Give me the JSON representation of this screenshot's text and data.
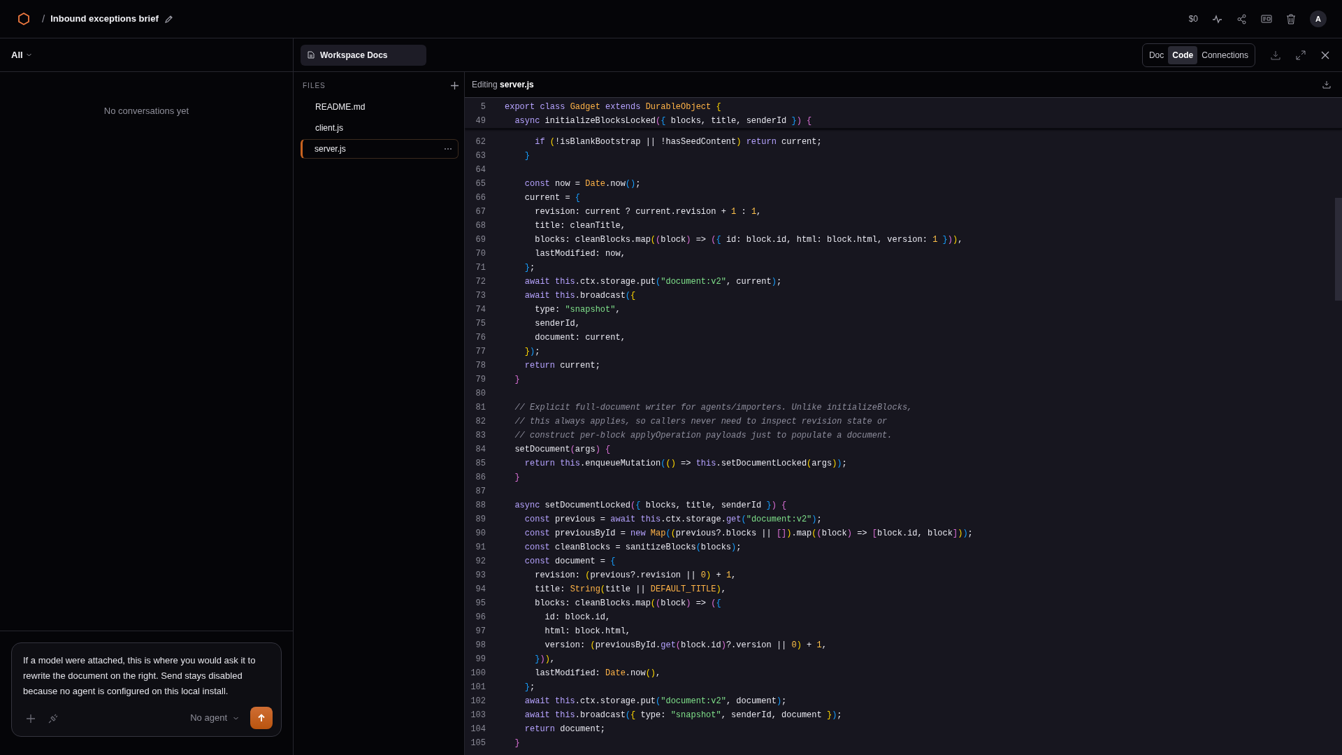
{
  "header": {
    "separator": "/",
    "title": "Inbound exceptions brief",
    "balance": "$0",
    "avatar": "A"
  },
  "sidebar": {
    "filter": "All",
    "empty_message": "No conversations yet",
    "composer": {
      "placeholder": "If a model were attached, this is where you would ask it to rewrite the document on the right. Send stays disabled because no agent is configured on this local install.",
      "agent": "No agent"
    }
  },
  "docs": {
    "tab": "Workspace Docs",
    "views": [
      {
        "label": "Doc",
        "selected": false
      },
      {
        "label": "Code",
        "selected": true
      },
      {
        "label": "Connections",
        "selected": false
      }
    ]
  },
  "files": {
    "heading": "FILES",
    "items": [
      {
        "name": "README.md",
        "selected": false
      },
      {
        "name": "client.js",
        "selected": false
      },
      {
        "name": "server.js",
        "selected": true
      }
    ]
  },
  "editor": {
    "status": "Editing",
    "file": "server.js",
    "sticky_lines": [
      {
        "number": "5",
        "tokens": [
          {
            "kind": "keyword",
            "text": "export class "
          },
          {
            "kind": "type",
            "text": "Gadget"
          },
          {
            "kind": "keyword",
            "text": " extends "
          },
          {
            "kind": "type",
            "text": "DurableObject "
          },
          {
            "kind": "bracket1",
            "text": "{"
          }
        ]
      },
      {
        "number": "49",
        "tokens": [
          {
            "kind": "keyword",
            "text": "  async "
          },
          {
            "kind": "plain",
            "text": "initializeBlocksLocked"
          },
          {
            "kind": "bracket2",
            "text": "("
          },
          {
            "kind": "bracket3",
            "text": "{"
          },
          {
            "kind": "plain",
            "text": " blocks, title, senderId "
          },
          {
            "kind": "bracket3",
            "text": "}"
          },
          {
            "kind": "bracket2",
            "text": ") {"
          }
        ]
      }
    ],
    "lines": [
      {
        "number": "62",
        "tokens": [
          {
            "kind": "keyword",
            "text": "      if "
          },
          {
            "kind": "bracket1",
            "text": "("
          },
          {
            "kind": "plain",
            "text": "!isBlankBootstrap || !hasSeedContent"
          },
          {
            "kind": "bracket1",
            "text": ")"
          },
          {
            "kind": "keyword",
            "text": " return"
          },
          {
            "kind": "plain",
            "text": " current;"
          }
        ]
      },
      {
        "number": "63",
        "tokens": [
          {
            "kind": "bracket3",
            "text": "    }"
          }
        ]
      },
      {
        "number": "64"
      },
      {
        "number": "65",
        "tokens": [
          {
            "kind": "keyword",
            "text": "    const"
          },
          {
            "kind": "plain",
            "text": " now = "
          },
          {
            "kind": "type",
            "text": "Date"
          },
          {
            "kind": "plain",
            "text": ".now"
          },
          {
            "kind": "bracket3",
            "text": "()"
          },
          {
            "kind": "plain",
            "text": ";"
          }
        ]
      },
      {
        "number": "66",
        "tokens": [
          {
            "kind": "plain",
            "text": "    current = "
          },
          {
            "kind": "bracket3",
            "text": "{"
          }
        ]
      },
      {
        "number": "67",
        "tokens": [
          {
            "kind": "plain",
            "text": "      revision: current ? current.revision + "
          },
          {
            "kind": "number",
            "text": "1"
          },
          {
            "kind": "plain",
            "text": " : "
          },
          {
            "kind": "number",
            "text": "1"
          },
          {
            "kind": "plain",
            "text": ","
          }
        ]
      },
      {
        "number": "68",
        "tokens": [
          {
            "kind": "plain",
            "text": "      title: cleanTitle,"
          }
        ]
      },
      {
        "number": "69",
        "tokens": [
          {
            "kind": "plain",
            "text": "      blocks: cleanBlocks.map"
          },
          {
            "kind": "bracket1",
            "text": "("
          },
          {
            "kind": "bracket2",
            "text": "("
          },
          {
            "kind": "plain",
            "text": "block"
          },
          {
            "kind": "bracket2",
            "text": ")"
          },
          {
            "kind": "plain",
            "text": " => "
          },
          {
            "kind": "bracket2",
            "text": "("
          },
          {
            "kind": "bracket3",
            "text": "{"
          },
          {
            "kind": "plain",
            "text": " id: block.id, html: block.html, version: "
          },
          {
            "kind": "number",
            "text": "1 "
          },
          {
            "kind": "bracket3",
            "text": "}"
          },
          {
            "kind": "bracket2",
            "text": ")"
          },
          {
            "kind": "bracket1",
            "text": ")"
          },
          {
            "kind": "plain",
            "text": ","
          }
        ]
      },
      {
        "number": "70",
        "tokens": [
          {
            "kind": "plain",
            "text": "      lastModified: now,"
          }
        ]
      },
      {
        "number": "71",
        "tokens": [
          {
            "kind": "bracket3",
            "text": "    }"
          },
          {
            "kind": "plain",
            "text": ";"
          }
        ]
      },
      {
        "number": "72",
        "tokens": [
          {
            "kind": "keyword",
            "text": "    await this"
          },
          {
            "kind": "plain",
            "text": ".ctx.storage.put"
          },
          {
            "kind": "bracket3",
            "text": "("
          },
          {
            "kind": "string",
            "text": "\"document:v2\""
          },
          {
            "kind": "plain",
            "text": ", current"
          },
          {
            "kind": "bracket3",
            "text": ")"
          },
          {
            "kind": "plain",
            "text": ";"
          }
        ]
      },
      {
        "number": "73",
        "tokens": [
          {
            "kind": "keyword",
            "text": "    await this"
          },
          {
            "kind": "plain",
            "text": ".broadcast"
          },
          {
            "kind": "bracket3",
            "text": "("
          },
          {
            "kind": "bracket1",
            "text": "{"
          }
        ]
      },
      {
        "number": "74",
        "tokens": [
          {
            "kind": "plain",
            "text": "      type: "
          },
          {
            "kind": "string",
            "text": "\"snapshot\""
          },
          {
            "kind": "plain",
            "text": ","
          }
        ]
      },
      {
        "number": "75",
        "tokens": [
          {
            "kind": "plain",
            "text": "      senderId,"
          }
        ]
      },
      {
        "number": "76",
        "tokens": [
          {
            "kind": "plain",
            "text": "      document: current,"
          }
        ]
      },
      {
        "number": "77",
        "tokens": [
          {
            "kind": "bracket1",
            "text": "    }"
          },
          {
            "kind": "bracket3",
            "text": ")"
          },
          {
            "kind": "plain",
            "text": ";"
          }
        ]
      },
      {
        "number": "78",
        "tokens": [
          {
            "kind": "keyword",
            "text": "    return"
          },
          {
            "kind": "plain",
            "text": " current;"
          }
        ]
      },
      {
        "number": "79",
        "tokens": [
          {
            "kind": "bracket2",
            "text": "  }"
          }
        ]
      },
      {
        "number": "80"
      },
      {
        "number": "81",
        "tokens": [
          {
            "kind": "comment",
            "text": "  // Explicit full-document writer for agents/importers. Unlike initializeBlocks,"
          }
        ]
      },
      {
        "number": "82",
        "tokens": [
          {
            "kind": "comment",
            "text": "  // this always applies, so callers never need to inspect revision state or"
          }
        ]
      },
      {
        "number": "83",
        "tokens": [
          {
            "kind": "comment",
            "text": "  // construct per-block applyOperation payloads just to populate a document."
          }
        ]
      },
      {
        "number": "84",
        "tokens": [
          {
            "kind": "plain",
            "text": "  setDocument"
          },
          {
            "kind": "bracket2",
            "text": "("
          },
          {
            "kind": "plain",
            "text": "args"
          },
          {
            "kind": "bracket2",
            "text": ") {"
          }
        ]
      },
      {
        "number": "85",
        "tokens": [
          {
            "kind": "keyword",
            "text": "    return this"
          },
          {
            "kind": "plain",
            "text": ".enqueueMutation"
          },
          {
            "kind": "bracket3",
            "text": "("
          },
          {
            "kind": "bracket1",
            "text": "()"
          },
          {
            "kind": "plain",
            "text": " => "
          },
          {
            "kind": "keyword",
            "text": "this"
          },
          {
            "kind": "plain",
            "text": ".setDocumentLocked"
          },
          {
            "kind": "bracket1",
            "text": "("
          },
          {
            "kind": "plain",
            "text": "args"
          },
          {
            "kind": "bracket1",
            "text": ")"
          },
          {
            "kind": "bracket3",
            "text": ")"
          },
          {
            "kind": "plain",
            "text": ";"
          }
        ]
      },
      {
        "number": "86",
        "tokens": [
          {
            "kind": "bracket2",
            "text": "  }"
          }
        ]
      },
      {
        "number": "87"
      },
      {
        "number": "88",
        "tokens": [
          {
            "kind": "keyword",
            "text": "  async "
          },
          {
            "kind": "plain",
            "text": "setDocumentLocked"
          },
          {
            "kind": "bracket2",
            "text": "("
          },
          {
            "kind": "bracket3",
            "text": "{"
          },
          {
            "kind": "plain",
            "text": " blocks, title, senderId "
          },
          {
            "kind": "bracket3",
            "text": "}"
          },
          {
            "kind": "bracket2",
            "text": ") {"
          }
        ]
      },
      {
        "number": "89",
        "tokens": [
          {
            "kind": "keyword",
            "text": "    const"
          },
          {
            "kind": "plain",
            "text": " previous = "
          },
          {
            "kind": "keyword",
            "text": "await this"
          },
          {
            "kind": "plain",
            "text": ".ctx.storage."
          },
          {
            "kind": "keyword",
            "text": "get"
          },
          {
            "kind": "bracket3",
            "text": "("
          },
          {
            "kind": "string",
            "text": "\"document:v2\""
          },
          {
            "kind": "bracket3",
            "text": ")"
          },
          {
            "kind": "plain",
            "text": ";"
          }
        ]
      },
      {
        "number": "90",
        "tokens": [
          {
            "kind": "keyword",
            "text": "    const"
          },
          {
            "kind": "plain",
            "text": " previousById = "
          },
          {
            "kind": "keyword",
            "text": "new "
          },
          {
            "kind": "type",
            "text": "Map"
          },
          {
            "kind": "bracket3",
            "text": "("
          },
          {
            "kind": "bracket1",
            "text": "("
          },
          {
            "kind": "plain",
            "text": "previous?.blocks || "
          },
          {
            "kind": "bracket2",
            "text": "[]"
          },
          {
            "kind": "bracket1",
            "text": ")"
          },
          {
            "kind": "plain",
            "text": ".map"
          },
          {
            "kind": "bracket1",
            "text": "("
          },
          {
            "kind": "bracket2",
            "text": "("
          },
          {
            "kind": "plain",
            "text": "block"
          },
          {
            "kind": "bracket2",
            "text": ")"
          },
          {
            "kind": "plain",
            "text": " => "
          },
          {
            "kind": "bracket2",
            "text": "["
          },
          {
            "kind": "plain",
            "text": "block.id, block"
          },
          {
            "kind": "bracket2",
            "text": "]"
          },
          {
            "kind": "bracket1",
            "text": ")"
          },
          {
            "kind": "bracket3",
            "text": ")"
          },
          {
            "kind": "plain",
            "text": ";"
          }
        ]
      },
      {
        "number": "91",
        "tokens": [
          {
            "kind": "keyword",
            "text": "    const"
          },
          {
            "kind": "plain",
            "text": " cleanBlocks = sanitizeBlocks"
          },
          {
            "kind": "bracket3",
            "text": "("
          },
          {
            "kind": "plain",
            "text": "blocks"
          },
          {
            "kind": "bracket3",
            "text": ")"
          },
          {
            "kind": "plain",
            "text": ";"
          }
        ]
      },
      {
        "number": "92",
        "tokens": [
          {
            "kind": "keyword",
            "text": "    const"
          },
          {
            "kind": "plain",
            "text": " document = "
          },
          {
            "kind": "bracket3",
            "text": "{"
          }
        ]
      },
      {
        "number": "93",
        "tokens": [
          {
            "kind": "plain",
            "text": "      revision: "
          },
          {
            "kind": "bracket1",
            "text": "("
          },
          {
            "kind": "plain",
            "text": "previous?.revision || "
          },
          {
            "kind": "number",
            "text": "0"
          },
          {
            "kind": "bracket1",
            "text": ")"
          },
          {
            "kind": "plain",
            "text": " + "
          },
          {
            "kind": "number",
            "text": "1"
          },
          {
            "kind": "plain",
            "text": ","
          }
        ]
      },
      {
        "number": "94",
        "tokens": [
          {
            "kind": "plain",
            "text": "      title: "
          },
          {
            "kind": "type",
            "text": "String"
          },
          {
            "kind": "bracket1",
            "text": "("
          },
          {
            "kind": "plain",
            "text": "title || "
          },
          {
            "kind": "type",
            "text": "DEFAULT_TITLE"
          },
          {
            "kind": "bracket1",
            "text": ")"
          },
          {
            "kind": "plain",
            "text": ","
          }
        ]
      },
      {
        "number": "95",
        "tokens": [
          {
            "kind": "plain",
            "text": "      blocks: cleanBlocks.map"
          },
          {
            "kind": "bracket1",
            "text": "("
          },
          {
            "kind": "bracket2",
            "text": "("
          },
          {
            "kind": "plain",
            "text": "block"
          },
          {
            "kind": "bracket2",
            "text": ")"
          },
          {
            "kind": "plain",
            "text": " => "
          },
          {
            "kind": "bracket2",
            "text": "("
          },
          {
            "kind": "bracket3",
            "text": "{"
          }
        ]
      },
      {
        "number": "96",
        "tokens": [
          {
            "kind": "plain",
            "text": "        id: block.id,"
          }
        ]
      },
      {
        "number": "97",
        "tokens": [
          {
            "kind": "plain",
            "text": "        html: block.html,"
          }
        ]
      },
      {
        "number": "98",
        "tokens": [
          {
            "kind": "plain",
            "text": "        version: "
          },
          {
            "kind": "bracket1",
            "text": "("
          },
          {
            "kind": "plain",
            "text": "previousById."
          },
          {
            "kind": "keyword",
            "text": "get"
          },
          {
            "kind": "bracket2",
            "text": "("
          },
          {
            "kind": "plain",
            "text": "block.id"
          },
          {
            "kind": "bracket2",
            "text": ")"
          },
          {
            "kind": "plain",
            "text": "?.version || "
          },
          {
            "kind": "number",
            "text": "0"
          },
          {
            "kind": "bracket1",
            "text": ")"
          },
          {
            "kind": "plain",
            "text": " + "
          },
          {
            "kind": "number",
            "text": "1"
          },
          {
            "kind": "plain",
            "text": ","
          }
        ]
      },
      {
        "number": "99",
        "tokens": [
          {
            "kind": "bracket3",
            "text": "      }"
          },
          {
            "kind": "bracket2",
            "text": ")"
          },
          {
            "kind": "bracket1",
            "text": ")"
          },
          {
            "kind": "plain",
            "text": ","
          }
        ]
      },
      {
        "number": "100",
        "tokens": [
          {
            "kind": "plain",
            "text": "      lastModified: "
          },
          {
            "kind": "type",
            "text": "Date"
          },
          {
            "kind": "plain",
            "text": ".now"
          },
          {
            "kind": "bracket1",
            "text": "()"
          },
          {
            "kind": "plain",
            "text": ","
          }
        ]
      },
      {
        "number": "101",
        "tokens": [
          {
            "kind": "bracket3",
            "text": "    }"
          },
          {
            "kind": "plain",
            "text": ";"
          }
        ]
      },
      {
        "number": "102",
        "tokens": [
          {
            "kind": "keyword",
            "text": "    await this"
          },
          {
            "kind": "plain",
            "text": ".ctx.storage.put"
          },
          {
            "kind": "bracket3",
            "text": "("
          },
          {
            "kind": "string",
            "text": "\"document:v2\""
          },
          {
            "kind": "plain",
            "text": ", document"
          },
          {
            "kind": "bracket3",
            "text": ")"
          },
          {
            "kind": "plain",
            "text": ";"
          }
        ]
      },
      {
        "number": "103",
        "tokens": [
          {
            "kind": "keyword",
            "text": "    await this"
          },
          {
            "kind": "plain",
            "text": ".broadcast"
          },
          {
            "kind": "bracket3",
            "text": "("
          },
          {
            "kind": "bracket1",
            "text": "{"
          },
          {
            "kind": "plain",
            "text": " type: "
          },
          {
            "kind": "string",
            "text": "\"snapshot\""
          },
          {
            "kind": "plain",
            "text": ", senderId, document "
          },
          {
            "kind": "bracket1",
            "text": "}"
          },
          {
            "kind": "bracket3",
            "text": ")"
          },
          {
            "kind": "plain",
            "text": ";"
          }
        ]
      },
      {
        "number": "104",
        "tokens": [
          {
            "kind": "keyword",
            "text": "    return"
          },
          {
            "kind": "plain",
            "text": " document;"
          }
        ]
      },
      {
        "number": "105",
        "tokens": [
          {
            "kind": "bracket2",
            "text": "  }"
          }
        ]
      }
    ]
  }
}
